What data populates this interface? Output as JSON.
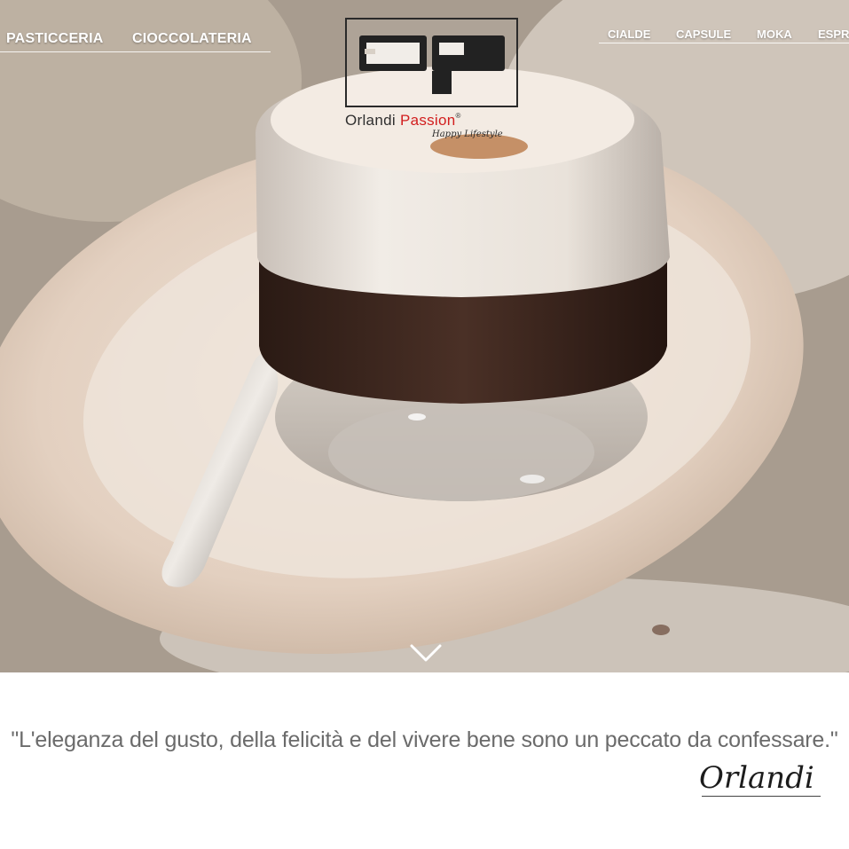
{
  "nav_left": {
    "items": [
      {
        "label": "PASTICCERIA"
      },
      {
        "label": "CIOCCOLATERIA"
      }
    ]
  },
  "nav_right": {
    "items": [
      {
        "label": "CIALDE"
      },
      {
        "label": "CAPSULE"
      },
      {
        "label": "MOKA"
      },
      {
        "label": "ESPR"
      }
    ]
  },
  "logo": {
    "name_part1": "Orlandi",
    "name_part2": "Passion",
    "registered": "®",
    "tagline": "Happy Lifestyle",
    "brand_red": "#d21e1e"
  },
  "hero": {
    "scroll_icon": "chevron-down-icon"
  },
  "quote": {
    "text": "\"L'eleganza del gusto, della felicità e del vivere bene sono un peccato da confessare.\"",
    "signature": "Orlandi"
  }
}
